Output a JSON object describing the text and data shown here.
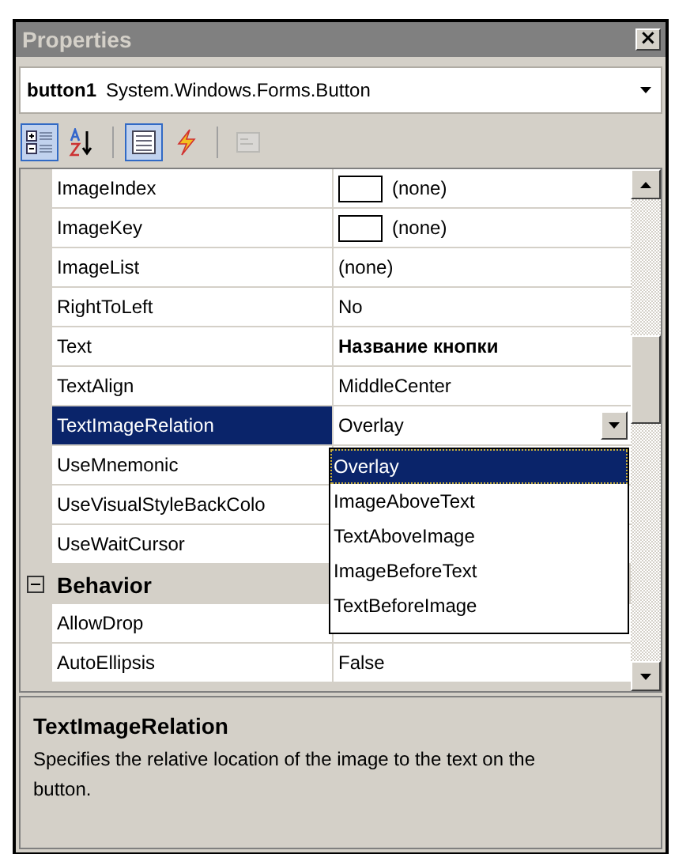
{
  "window": {
    "title": "Properties",
    "close": "×"
  },
  "object_selector": {
    "name": "button1",
    "type": "System.Windows.Forms.Button"
  },
  "toolbar": [
    {
      "kind": "categorized",
      "selected": true,
      "disabled": false
    },
    {
      "kind": "alphabetical",
      "selected": false,
      "disabled": false
    },
    {
      "kind": "properties",
      "selected": true,
      "disabled": false
    },
    {
      "kind": "events",
      "selected": false,
      "disabled": false
    },
    {
      "kind": "pages",
      "selected": false,
      "disabled": true
    }
  ],
  "rows": [
    {
      "kind": "property",
      "name": "ImageIndex",
      "value": "(none)",
      "swatch": true,
      "selected": false
    },
    {
      "kind": "property",
      "name": "ImageKey",
      "value": "(none)",
      "swatch": true,
      "selected": false
    },
    {
      "kind": "property",
      "name": "ImageList",
      "value": "(none)",
      "selected": false
    },
    {
      "kind": "property",
      "name": "RightToLeft",
      "value": "No",
      "selected": false
    },
    {
      "kind": "property",
      "name": "Text",
      "value": "Название кнопки",
      "bold": true,
      "selected": false
    },
    {
      "kind": "property",
      "name": "TextAlign",
      "value": "MiddleCenter",
      "selected": false
    },
    {
      "kind": "property",
      "name": "TextImageRelation",
      "value": "Overlay",
      "selected": true,
      "dropdown": true
    },
    {
      "kind": "property",
      "name": "UseMnemonic",
      "selected": false
    },
    {
      "kind": "property",
      "name": "UseVisualStyleBackColo",
      "selected": false
    },
    {
      "kind": "property",
      "name": "UseWaitCursor",
      "selected": false
    },
    {
      "kind": "category",
      "name": "Behavior",
      "expanded": true
    },
    {
      "kind": "property",
      "name": "AllowDrop",
      "selected": false
    },
    {
      "kind": "property",
      "name": "AutoEllipsis",
      "value": "False",
      "selected": false
    }
  ],
  "dropdown_list": [
    {
      "label": "Overlay",
      "selected": true
    },
    {
      "label": "ImageAboveText",
      "selected": false
    },
    {
      "label": "TextAboveImage",
      "selected": false
    },
    {
      "label": "ImageBeforeText",
      "selected": false
    },
    {
      "label": "TextBeforeImage",
      "selected": false
    }
  ],
  "description": {
    "title": "TextImageRelation",
    "text": "Specifies the relative location of the image to the text on the button."
  }
}
